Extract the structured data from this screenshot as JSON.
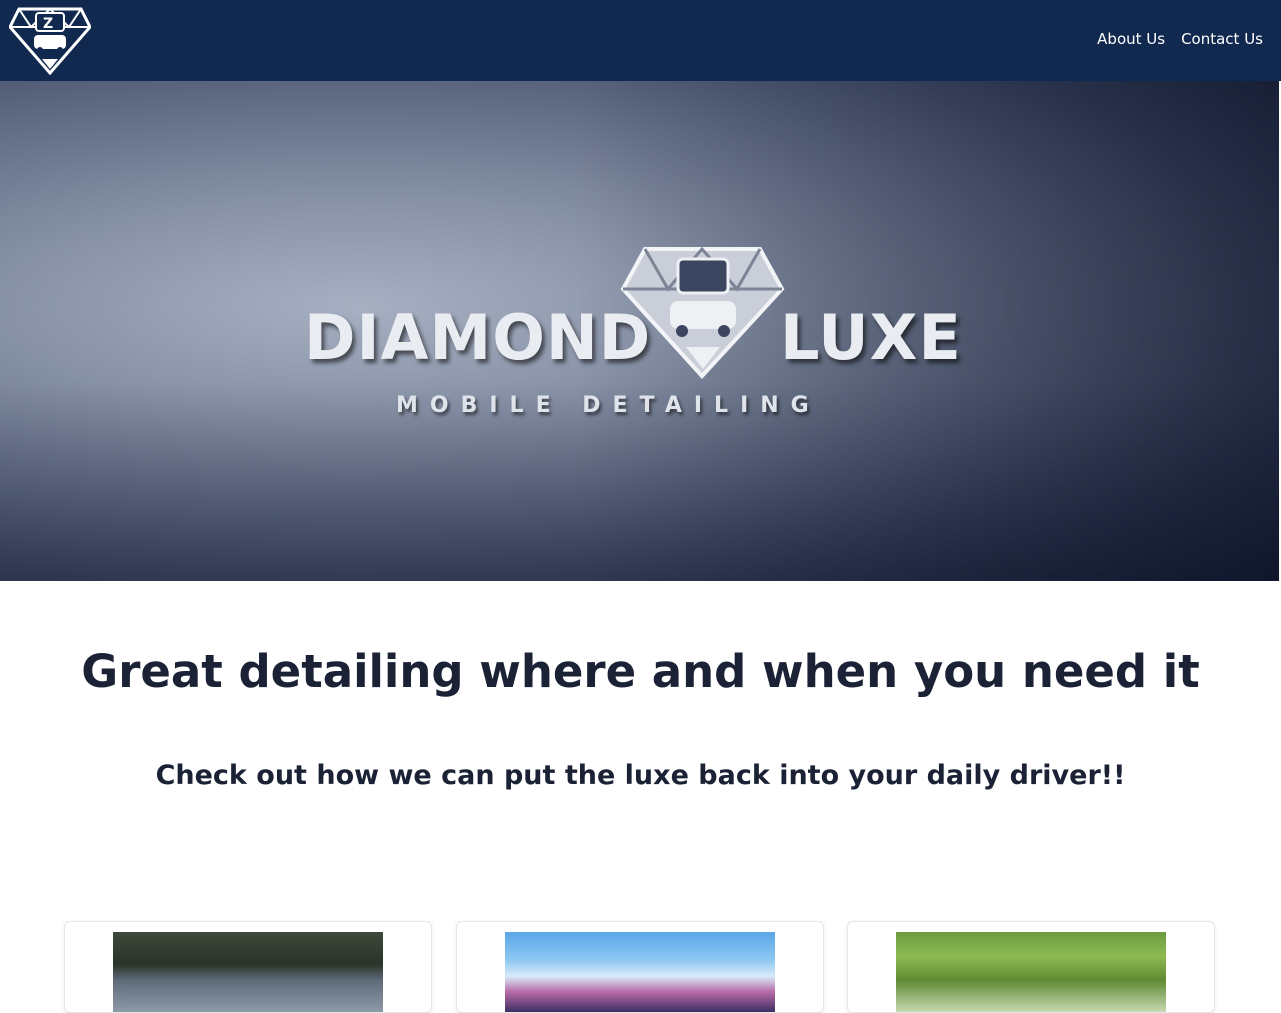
{
  "nav": {
    "logo_icon": "diamond-car-logo-icon",
    "links": [
      {
        "label": "About Us"
      },
      {
        "label": "Contact Us"
      }
    ]
  },
  "hero": {
    "brand_left": "DIAMOND",
    "brand_right": "LUXE",
    "tagline": "MOBILE DETAILING"
  },
  "main": {
    "headline": "Great detailing where and when you need it",
    "subheadline": "Check out how we can put the luxe back into your daily driver!!"
  },
  "cards": [
    {
      "image": "car-photo"
    },
    {
      "image": "van-photo"
    },
    {
      "image": "trees-photo"
    }
  ],
  "colors": {
    "navbar": "#12294f",
    "text": "#1b2236"
  }
}
